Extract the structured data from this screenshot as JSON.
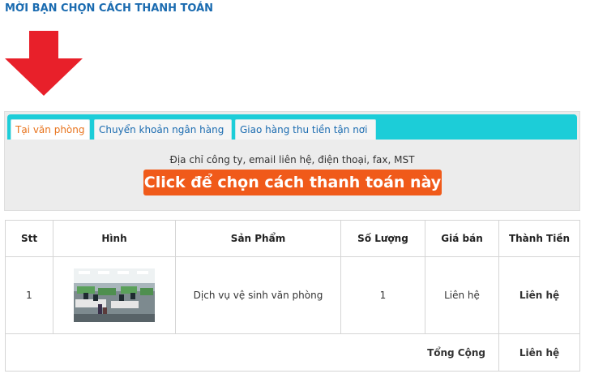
{
  "header": {
    "title": "MỜI BẠN CHỌN CÁCH THANH TOÁN"
  },
  "icons": {
    "arrow": "down-arrow-icon",
    "arrow_color": "#e8202a"
  },
  "payment": {
    "tabs": [
      {
        "label": "Tại văn phòng",
        "active": true
      },
      {
        "label": "Chuyển khoản ngân hàng",
        "active": false
      },
      {
        "label": "Giao hàng thu tiền tận nơi",
        "active": false
      }
    ],
    "description": "Địa chỉ công ty, email liên hệ, điện thoại, fax, MST",
    "choose_button": "Click để chọn cách thanh toán này"
  },
  "cart": {
    "headers": [
      "Stt",
      "Hình",
      "Sản Phẩm",
      "Số Lượng",
      "Giá bán",
      "Thành Tiền"
    ],
    "rows": [
      {
        "stt": "1",
        "product": "Dịch vụ vệ sinh văn phòng",
        "quantity": "1",
        "price": "Liên hệ",
        "total": "Liên hệ"
      }
    ],
    "total_label": "Tổng Cộng",
    "total_value": "Liên hệ"
  },
  "colors": {
    "title": "#1a6bb0",
    "tabbar": "#1ccdd8",
    "active_tab": "#e8731c",
    "button": "#f05a1a",
    "price_red": "#d8000c"
  }
}
